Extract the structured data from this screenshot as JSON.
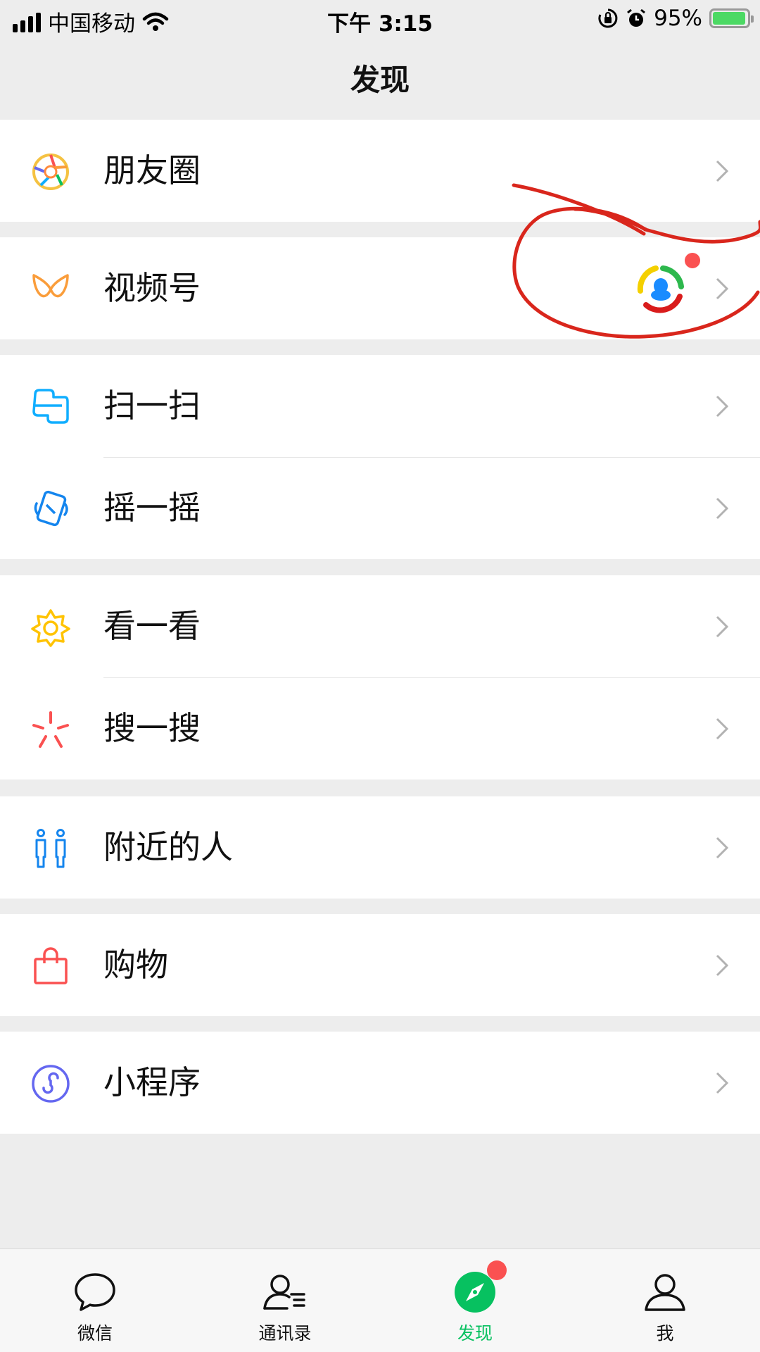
{
  "status_bar": {
    "carrier": "中国移动",
    "time": "下午 3:15",
    "battery_percent": "95%",
    "battery_level": 0.95,
    "icons": [
      "signal-icon",
      "wifi-icon",
      "orientation-lock-icon",
      "alarm-icon",
      "battery-charging-icon"
    ]
  },
  "header": {
    "title": "发现"
  },
  "menu": {
    "moments": {
      "label": "朋友圈",
      "icon": "moments-aperture-icon"
    },
    "channels": {
      "label": "视频号",
      "icon": "channels-icon",
      "has_new_badge": true,
      "badge_icon": "channel-avatar-icon"
    },
    "scan": {
      "label": "扫一扫",
      "icon": "scan-icon"
    },
    "shake": {
      "label": "摇一摇",
      "icon": "shake-icon"
    },
    "top_stories": {
      "label": "看一看",
      "icon": "top-stories-icon"
    },
    "search": {
      "label": "搜一搜",
      "icon": "search-icon"
    },
    "nearby": {
      "label": "附近的人",
      "icon": "people-nearby-icon"
    },
    "shopping": {
      "label": "购物",
      "icon": "shopping-bag-icon"
    },
    "mini_programs": {
      "label": "小程序",
      "icon": "mini-program-icon"
    }
  },
  "tabbar": {
    "tabs": [
      {
        "label": "微信",
        "icon": "chat-bubble-icon",
        "active": false
      },
      {
        "label": "通讯录",
        "icon": "contacts-icon",
        "active": false
      },
      {
        "label": "发现",
        "icon": "compass-icon",
        "active": true,
        "has_badge": true
      },
      {
        "label": "我",
        "icon": "me-icon",
        "active": false
      }
    ]
  },
  "colors": {
    "background": "#ededed",
    "accent_green": "#07c160",
    "badge_red": "#fa5151",
    "annotation_red": "#d9261c"
  }
}
